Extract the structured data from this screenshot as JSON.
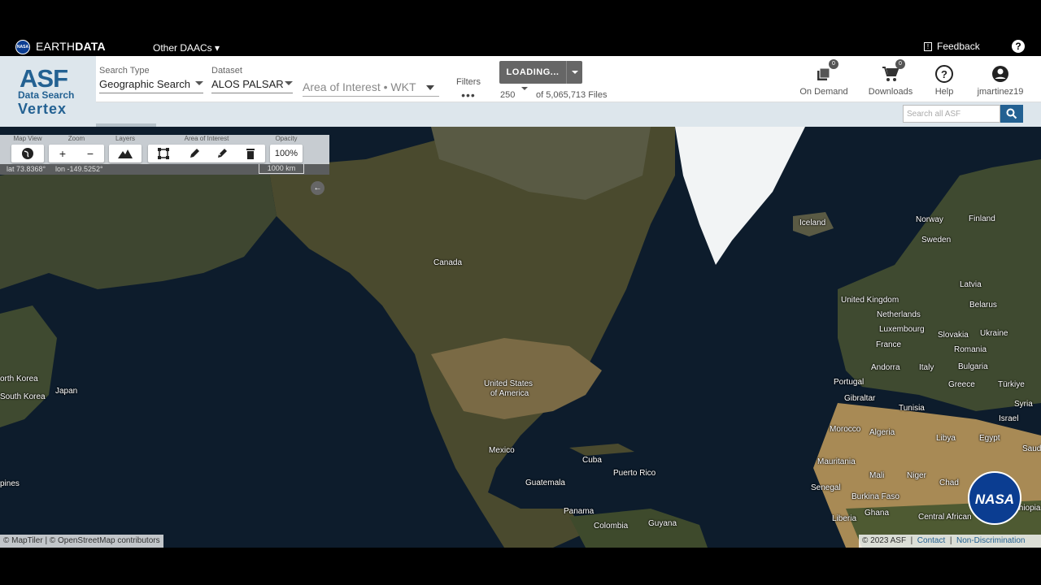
{
  "earthdata_bar": {
    "nasa_mini": "NASA",
    "brand_light": "EARTH",
    "brand_bold": "DATA",
    "other_daacs": "Other DAACs ▾",
    "feedback": "Feedback",
    "help": "?"
  },
  "logo": {
    "asf": "ASF",
    "data_search": "Data Search",
    "vertex": "Vertex"
  },
  "search": {
    "search_type_label": "Search Type",
    "search_type_value": "Geographic Search",
    "dataset_label": "Dataset",
    "dataset_value": "ALOS PALSAR",
    "aoi_placeholder": "Area of Interest • WKT",
    "filters_label": "Filters",
    "filters_dots": "•••",
    "loading_label": "LOADING...",
    "max_results": "250",
    "files_count": "of 5,065,713 Files"
  },
  "header_buttons": [
    {
      "label": "On Demand",
      "badge": "0"
    },
    {
      "label": "Downloads",
      "badge": "0"
    },
    {
      "label": "Help"
    },
    {
      "label": "jmartinez19"
    }
  ],
  "search_all_placeholder": "Search all ASF",
  "map_toolbar": {
    "map_view": "Map View",
    "zoom": "Zoom",
    "layers": "Layers",
    "area_of_interest": "Area of Interest",
    "opacity": "Opacity",
    "opacity_value": "100%",
    "zoom_in": "+",
    "zoom_out": "−",
    "lat": "lat 73.8368°",
    "lon": "lon -149.5252°",
    "scale": "1000 km"
  },
  "map_labels": {
    "canada": "Canada",
    "iceland": "Iceland",
    "norway": "Norway",
    "finland": "Finland",
    "sweden": "Sweden",
    "latvia": "Latvia",
    "uk": "United Kingdom",
    "belarus": "Belarus",
    "netherlands": "Netherlands",
    "luxembourg": "Luxembourg",
    "slovakia": "Slovakia",
    "ukraine": "Ukraine",
    "france": "France",
    "romania": "Romania",
    "andorra": "Andorra",
    "italy": "Italy",
    "bulgaria": "Bulgaria",
    "portugal": "Portugal",
    "greece": "Greece",
    "turkiye": "Türkiye",
    "gibraltar": "Gibraltar",
    "tunisia": "Tunisia",
    "syria": "Syria",
    "israel": "Israel",
    "us": "United States",
    "us2": "of America",
    "north_korea": "orth Korea",
    "south_korea": "South Korea",
    "japan": "Japan",
    "morocco": "Morocco",
    "algeria": "Algeria",
    "libya": "Libya",
    "egypt": "Egypt",
    "saudi": "Saud",
    "mexico": "Mexico",
    "cuba": "Cuba",
    "mauritania": "Mauritania",
    "mali": "Mali",
    "niger": "Niger",
    "chad": "Chad",
    "puerto_rico": "Puerto Rico",
    "philippines": "pines",
    "guatemala": "Guatemala",
    "senegal": "Senegal",
    "burkina": "Burkina Faso",
    "ethiopia": "thiopia",
    "panama": "Panama",
    "ghana": "Ghana",
    "liberia": "Liberia",
    "car": "Central African",
    "colombia": "Colombia",
    "guyana": "Guyana"
  },
  "attribution": {
    "left": "© MapTiler | © OpenStreetMap contributors",
    "copyright": "© 2023 ASF",
    "contact": "Contact",
    "nondisc": "Non-Discrimination"
  },
  "nasa_watermark": "NASA",
  "colors": {
    "brand_blue": "#236192",
    "ocean": "#0d1c2c",
    "land": "#4a4a2e",
    "ice": "#f2f4f5"
  }
}
